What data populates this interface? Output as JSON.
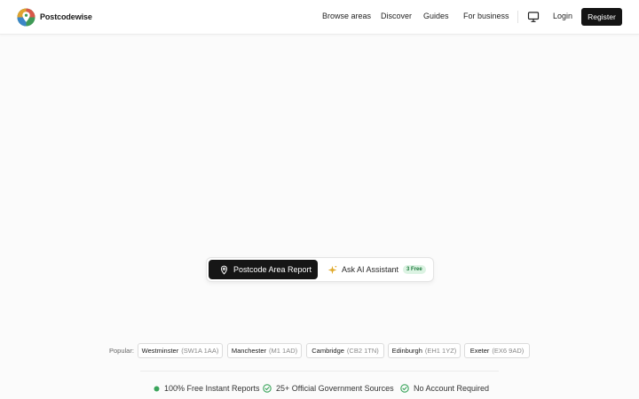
{
  "brand": {
    "name": "Postcodewise",
    "logo_icon": "map-pin-globe-icon"
  },
  "nav": {
    "links": [
      "Browse areas",
      "Discover",
      "Guides",
      "For business"
    ],
    "display_icon": "monitor-icon",
    "login_label": "Login",
    "register_label": "Register"
  },
  "mode_switch": {
    "active_tab": {
      "label": "Postcode Area Report",
      "icon": "map-pin-icon"
    },
    "inactive_tab": {
      "label": "Ask AI Assistant",
      "icon": "sparkle-icon",
      "badge": "3 Free"
    }
  },
  "popular": {
    "label": "Popular:",
    "items": [
      {
        "name": "Westminster",
        "code": "(SW1A 1AA)"
      },
      {
        "name": "Manchester",
        "code": "(M1 1AD)"
      },
      {
        "name": "Cambridge",
        "code": "(CB2 1TN)"
      },
      {
        "name": "Edinburgh",
        "code": "(EH1 1YZ)"
      },
      {
        "name": "Exeter",
        "code": "(EX6 9AD)"
      }
    ]
  },
  "features": [
    {
      "label": "100% Free Instant Reports",
      "icon": "green-dot-icon"
    },
    {
      "label": "25+ Official Government Sources",
      "icon": "check-circle-icon"
    },
    {
      "label": "No Account Required",
      "icon": "check-circle-icon"
    }
  ],
  "colors": {
    "primary": "#141414",
    "badge_bg": "#dcf3e3",
    "badge_text": "#1e7a3d",
    "check_green": "#3aa45b",
    "sparkle": "#e0a92a",
    "page_bg": "#fbfbfb"
  }
}
